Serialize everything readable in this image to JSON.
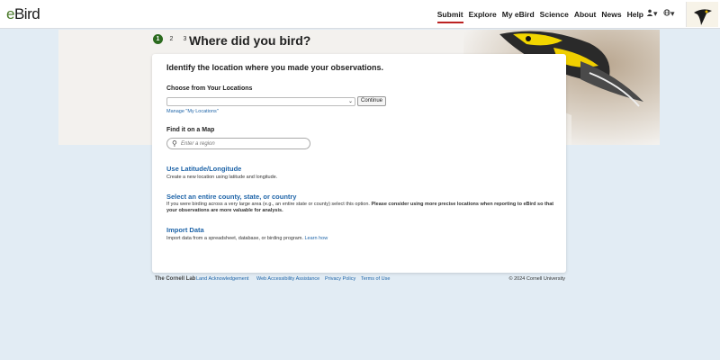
{
  "header": {
    "logo_prefix": "e",
    "logo_suffix": "Bird",
    "nav": [
      "Submit",
      "Explore",
      "My eBird",
      "Science",
      "About",
      "News",
      "Help"
    ],
    "user_icon": "person-icon",
    "lang_icon": "globe-icon"
  },
  "steps": [
    "1",
    "2",
    "3"
  ],
  "page_title": "Where did you bird?",
  "card": {
    "heading": "Identify the location where you made your observations.",
    "choose_label": "Choose from Your Locations",
    "select_value": "",
    "continue_label": "Continue",
    "manage_link": "Manage \"My Locations\"",
    "map_label": "Find it on a Map",
    "search_placeholder": "Enter a region",
    "latlong_title": "Use Latitude/Longitude",
    "latlong_desc": "Create a new location using latitude and longitude.",
    "region_title": "Select an entire county, state, or country",
    "region_desc_plain": "If you were birding across a very large area (e.g., an entire state or county) select this option. ",
    "region_desc_bold": "Please consider using more precise locations when reporting to eBird so that your observations are more valuable for analysis.",
    "import_title": "Import Data",
    "import_desc": "Import data from a spreadsheet, database, or birding program.",
    "import_link": "Learn how"
  },
  "footer": {
    "cornell": "The Cornell Lab",
    "links": [
      "Land Acknowledgement",
      "Web Accessibility Assistance",
      "Privacy Policy",
      "Terms of Use"
    ],
    "copyright": "© 2024 Cornell University"
  },
  "colors": {
    "accent_green": "#2b6a1e",
    "link_blue": "#1e64a8",
    "active_underline": "#bb2222",
    "background": "#e2ecf4"
  }
}
